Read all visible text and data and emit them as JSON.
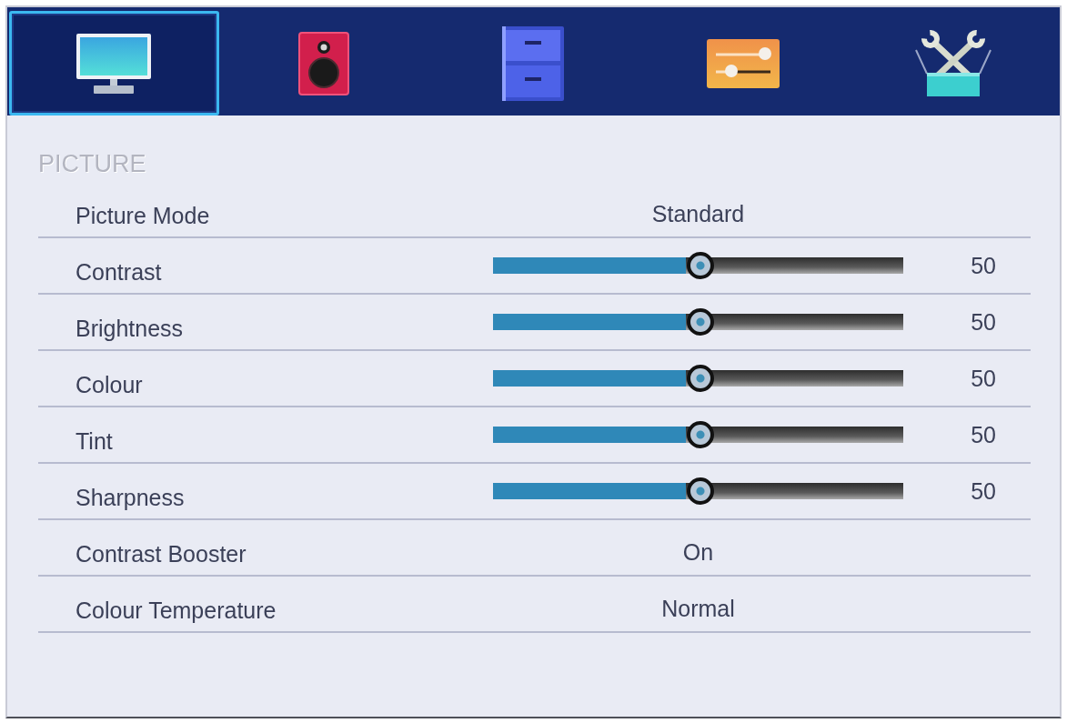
{
  "tabs": [
    {
      "selected": true
    },
    {
      "selected": false
    },
    {
      "selected": false
    },
    {
      "selected": false
    },
    {
      "selected": false
    }
  ],
  "section": {
    "title": "PICTURE"
  },
  "rows": [
    {
      "kind": "option",
      "label": "Picture Mode",
      "value": "Standard"
    },
    {
      "kind": "slider",
      "label": "Contrast",
      "level": 0.5,
      "reading": "50"
    },
    {
      "kind": "slider",
      "label": "Brightness",
      "level": 0.5,
      "reading": "50"
    },
    {
      "kind": "slider",
      "label": "Colour",
      "level": 0.5,
      "reading": "50"
    },
    {
      "kind": "slider",
      "label": "Tint",
      "level": 0.5,
      "reading": "50"
    },
    {
      "kind": "slider",
      "label": "Sharpness",
      "level": 0.5,
      "reading": "50"
    },
    {
      "kind": "option",
      "label": "Contrast Booster",
      "value": "On"
    },
    {
      "kind": "option",
      "label": "Colour Temperature",
      "value": "Normal"
    }
  ]
}
